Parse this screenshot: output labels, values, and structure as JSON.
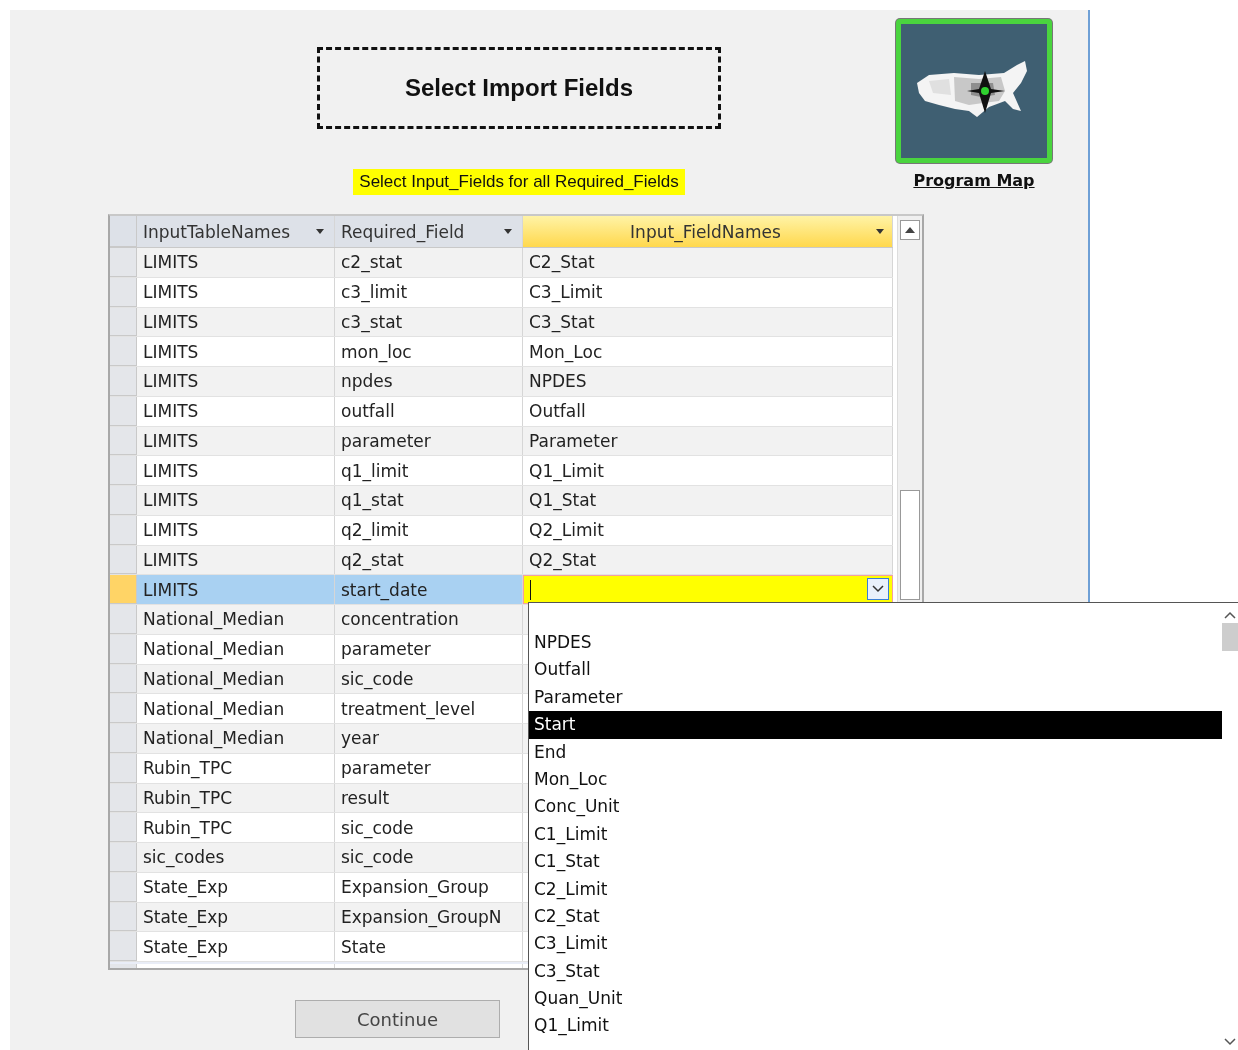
{
  "title": "Select Import Fields",
  "instruction": "Select Input_Fields for all Required_Fields",
  "map_link": "Program Map",
  "table": {
    "columns": [
      {
        "label": "InputTableNames",
        "selected": false
      },
      {
        "label": "Required_Field",
        "selected": false
      },
      {
        "label": "Input_FieldNames",
        "selected": true
      }
    ],
    "rows": [
      {
        "cells": [
          "LIMITS",
          "c2_stat",
          "C2_Stat"
        ],
        "selected": false
      },
      {
        "cells": [
          "LIMITS",
          "c3_limit",
          "C3_Limit"
        ],
        "selected": false
      },
      {
        "cells": [
          "LIMITS",
          "c3_stat",
          "C3_Stat"
        ],
        "selected": false
      },
      {
        "cells": [
          "LIMITS",
          "mon_loc",
          "Mon_Loc"
        ],
        "selected": false
      },
      {
        "cells": [
          "LIMITS",
          "npdes",
          "NPDES"
        ],
        "selected": false
      },
      {
        "cells": [
          "LIMITS",
          "outfall",
          "Outfall"
        ],
        "selected": false
      },
      {
        "cells": [
          "LIMITS",
          "parameter",
          "Parameter"
        ],
        "selected": false
      },
      {
        "cells": [
          "LIMITS",
          "q1_limit",
          "Q1_Limit"
        ],
        "selected": false
      },
      {
        "cells": [
          "LIMITS",
          "q1_stat",
          "Q1_Stat"
        ],
        "selected": false
      },
      {
        "cells": [
          "LIMITS",
          "q2_limit",
          "Q2_Limit"
        ],
        "selected": false
      },
      {
        "cells": [
          "LIMITS",
          "q2_stat",
          "Q2_Stat"
        ],
        "selected": false
      },
      {
        "cells": [
          "LIMITS",
          "start_date"
        ],
        "selected": true
      },
      {
        "cells": [
          "National_Median",
          "concentration"
        ],
        "selected": false
      },
      {
        "cells": [
          "National_Median",
          "parameter"
        ],
        "selected": false
      },
      {
        "cells": [
          "National_Median",
          "sic_code"
        ],
        "selected": false
      },
      {
        "cells": [
          "National_Median",
          "treatment_level"
        ],
        "selected": false
      },
      {
        "cells": [
          "National_Median",
          "year"
        ],
        "selected": false
      },
      {
        "cells": [
          "Rubin_TPC",
          "parameter"
        ],
        "selected": false
      },
      {
        "cells": [
          "Rubin_TPC",
          "result"
        ],
        "selected": false
      },
      {
        "cells": [
          "Rubin_TPC",
          "sic_code"
        ],
        "selected": false
      },
      {
        "cells": [
          "sic_codes",
          "sic_code"
        ],
        "selected": false
      },
      {
        "cells": [
          "State_Exp",
          "Expansion_Group"
        ],
        "selected": false
      },
      {
        "cells": [
          "State_Exp",
          "Expansion_GroupN"
        ],
        "selected": false
      },
      {
        "cells": [
          "State_Exp",
          "State"
        ],
        "selected": false
      }
    ]
  },
  "dropdown": {
    "items": [
      {
        "label": "NPDES",
        "selected": false
      },
      {
        "label": "Outfall",
        "selected": false
      },
      {
        "label": "Parameter",
        "selected": false
      },
      {
        "label": "Start",
        "selected": true
      },
      {
        "label": "End",
        "selected": false
      },
      {
        "label": "Mon_Loc",
        "selected": false
      },
      {
        "label": "Conc_Unit",
        "selected": false
      },
      {
        "label": "C1_Limit",
        "selected": false
      },
      {
        "label": "C1_Stat",
        "selected": false
      },
      {
        "label": "C2_Limit",
        "selected": false
      },
      {
        "label": "C2_Stat",
        "selected": false
      },
      {
        "label": "C3_Limit",
        "selected": false
      },
      {
        "label": "C3_Stat",
        "selected": false
      },
      {
        "label": "Quan_Unit",
        "selected": false
      },
      {
        "label": "Q1_Limit",
        "selected": false
      }
    ]
  },
  "buttons": [
    "Continue"
  ]
}
